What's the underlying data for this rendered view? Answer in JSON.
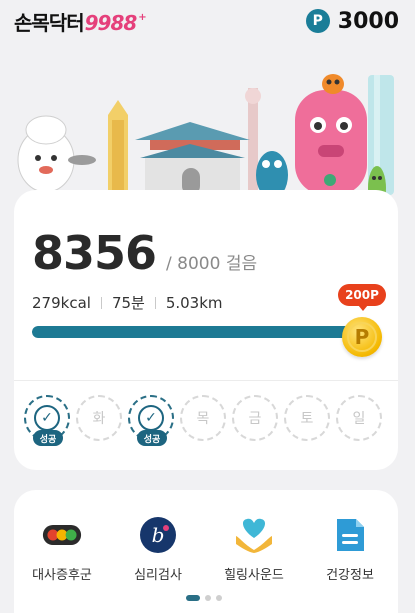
{
  "header": {
    "logo_text": "손목닥터",
    "logo_number": "9988",
    "logo_plus": "+",
    "point_icon": "P",
    "point_value": "3000"
  },
  "steps": {
    "count": "8356",
    "goal": "/ 8000 걸음",
    "calories": "279kcal",
    "minutes": "75분",
    "distance": "5.03km",
    "progress_fraction": 1.0,
    "reward_bubble": "200P",
    "coin_letter": "P"
  },
  "week": [
    {
      "label": "",
      "done": true,
      "badge": "성공"
    },
    {
      "label": "화",
      "done": false,
      "badge": ""
    },
    {
      "label": "",
      "done": true,
      "badge": "성공"
    },
    {
      "label": "목",
      "done": false,
      "badge": ""
    },
    {
      "label": "금",
      "done": false,
      "badge": ""
    },
    {
      "label": "토",
      "done": false,
      "badge": ""
    },
    {
      "label": "일",
      "done": false,
      "badge": ""
    }
  ],
  "menu": [
    {
      "label": "대사증후군",
      "icon": "traffic-light-icon"
    },
    {
      "label": "심리검사",
      "icon": "brain-test-icon"
    },
    {
      "label": "힐링사운드",
      "icon": "healing-heart-icon"
    },
    {
      "label": "건강정보",
      "icon": "health-info-icon"
    }
  ],
  "colors": {
    "accent": "#1d7a94",
    "brand_pink": "#e5407b",
    "bubble_red": "#e8411c",
    "coin_gold": "#f4b800"
  }
}
